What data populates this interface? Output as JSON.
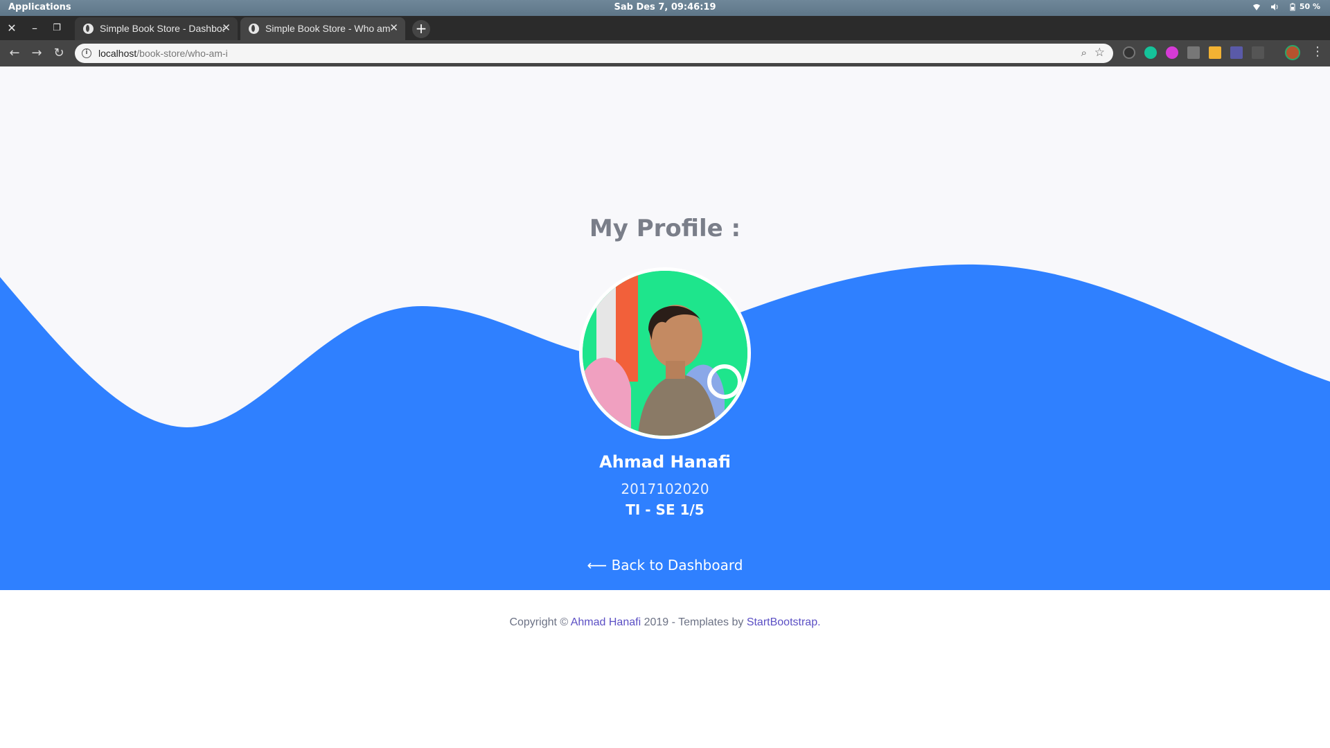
{
  "os": {
    "apps_label": "Applications",
    "clock": "Sab Des  7, 09:46:19",
    "battery": "50 %"
  },
  "browser": {
    "tabs": [
      {
        "label": "Simple Book Store - Dashboard",
        "active": false
      },
      {
        "label": "Simple Book Store - Who am i",
        "active": true
      }
    ],
    "url_host": "localhost",
    "url_path": "/book-store/who-am-i"
  },
  "page": {
    "heading": "My Profile :",
    "name": "Ahmad Hanafi",
    "student_id": "2017102020",
    "class": "TI - SE 1/5",
    "back_link": "⟵ Back to Dashboard"
  },
  "footer": {
    "prefix": "Copyright © ",
    "author": "Ahmad Hanafi",
    "middle": " 2019 - Templates by ",
    "templates": "StartBootstrap",
    "suffix": "."
  },
  "colors": {
    "wave": "#2f80ff",
    "heading": "#7a7e89",
    "footer_link": "#5b4fc4"
  }
}
